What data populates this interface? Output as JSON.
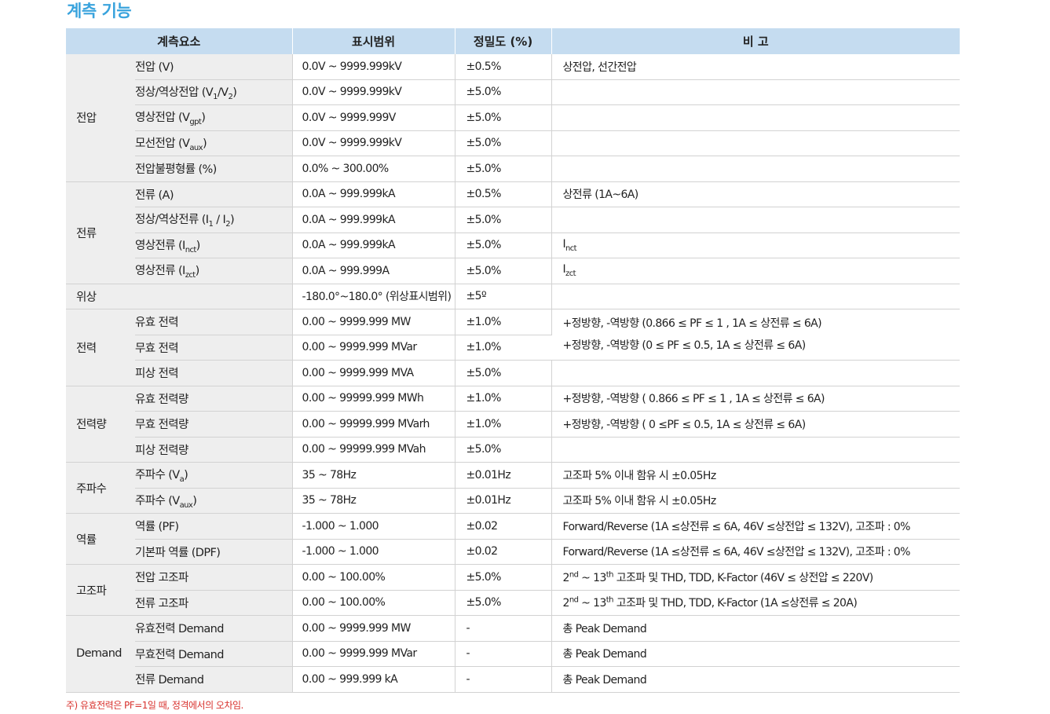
{
  "title": "계측 기능",
  "headers": {
    "element": "계측요소",
    "range": "표시범위",
    "accuracy": "정밀도 (%)",
    "note": "비 고"
  },
  "groups": [
    {
      "name": "전압",
      "rows": [
        {
          "item": "전압 (V)",
          "range": "0.0V ~ 9999.999kV",
          "accuracy": "±0.5%",
          "note": "상전압, 선간전압"
        },
        {
          "item": "정상/역상전압 (V1/V2)",
          "range": "0.0V ~ 9999.999kV",
          "accuracy": "±5.0%",
          "note": ""
        },
        {
          "item": "영상전압 (Vgpt)",
          "range": "0.0V ~ 9999.999V",
          "accuracy": "±5.0%",
          "note": ""
        },
        {
          "item": "모선전압 (Vaux)",
          "range": "0.0V ~ 9999.999kV",
          "accuracy": "±5.0%",
          "note": ""
        },
        {
          "item": "전압불평형률 (%)",
          "range": "0.0% ~ 300.00%",
          "accuracy": "±5.0%",
          "note": ""
        }
      ]
    },
    {
      "name": "전류",
      "rows": [
        {
          "item": "전류 (A)",
          "range": "0.0A ~ 999.999kA",
          "accuracy": "±0.5%",
          "note": "상전류 (1A~6A)"
        },
        {
          "item": "정상/역상전류 (I1 / I2)",
          "range": "0.0A ~ 999.999kA",
          "accuracy": "±5.0%",
          "note": ""
        },
        {
          "item": "영상전류 (Inct)",
          "range": "0.0A ~ 999.999kA",
          "accuracy": "±5.0%",
          "note": "Inct"
        },
        {
          "item": "영상전류 (Izct)",
          "range": "0.0A ~ 999.999A",
          "accuracy": "±5.0%",
          "note": "Izct"
        }
      ]
    },
    {
      "name": "위상",
      "rows": [
        {
          "item": "",
          "range": "-180.0°~180.0° (위상표시범위)",
          "accuracy": "±5º",
          "note": ""
        }
      ]
    },
    {
      "name": "전력",
      "rows": [
        {
          "item": "유효 전력",
          "range": "0.00 ~ 9999.999 MW",
          "accuracy": "±1.0%",
          "note": "+정방향, -역방향 (0.866 ≤ PF ≤ 1 , 1A ≤ 상전류 ≤ 6A)"
        },
        {
          "item": "무효 전력",
          "range": "0.00 ~ 9999.999 MVar",
          "accuracy": "±1.0%",
          "note": "+정방향, -역방향 (0 ≤ PF ≤ 0.5, 1A ≤ 상전류 ≤ 6A)"
        },
        {
          "item": "피상 전력",
          "range": "0.00 ~ 9999.999 MVA",
          "accuracy": "±5.0%",
          "note": ""
        }
      ]
    },
    {
      "name": "전력량",
      "rows": [
        {
          "item": "유효 전력량",
          "range": "0.00 ~ 99999.999 MWh",
          "accuracy": "±1.0%",
          "note": "+정방향, -역방향 ( 0.866 ≤ PF ≤ 1 , 1A ≤ 상전류 ≤ 6A)"
        },
        {
          "item": "무효 전력량",
          "range": "0.00 ~ 99999.999 MVarh",
          "accuracy": "±1.0%",
          "note": "+정방향, -역방향 ( 0 ≤PF ≤ 0.5, 1A ≤ 상전류 ≤ 6A)"
        },
        {
          "item": "피상 전력량",
          "range": "0.00 ~ 99999.999 MVah",
          "accuracy": "±5.0%",
          "note": ""
        }
      ]
    },
    {
      "name": "주파수",
      "rows": [
        {
          "item": "주파수 (Va)",
          "range": "35 ~ 78Hz",
          "accuracy": "±0.01Hz",
          "note": "고조파 5% 이내 함유 시 ±0.05Hz"
        },
        {
          "item": "주파수 (Vaux)",
          "range": "35 ~ 78Hz",
          "accuracy": "±0.01Hz",
          "note": "고조파 5% 이내 함유 시 ±0.05Hz"
        }
      ]
    },
    {
      "name": "역률",
      "rows": [
        {
          "item": "역률 (PF)",
          "range": "-1.000 ~ 1.000",
          "accuracy": "±0.02",
          "note": "Forward/Reverse (1A ≤상전류 ≤ 6A, 46V ≤상전압 ≤ 132V), 고조파 : 0%"
        },
        {
          "item": "기본파 역률 (DPF)",
          "range": "-1.000 ~ 1.000",
          "accuracy": "±0.02",
          "note": "Forward/Reverse (1A ≤상전류 ≤ 6A, 46V ≤상전압 ≤ 132V), 고조파 : 0%"
        }
      ]
    },
    {
      "name": "고조파",
      "rows": [
        {
          "item": "전압 고조파",
          "range": "0.00 ~ 100.00%",
          "accuracy": "±5.0%",
          "note": "2nd ~ 13th 고조파 및 THD, TDD, K-Factor (46V ≤ 상전압 ≤ 220V)"
        },
        {
          "item": "전류 고조파",
          "range": "0.00 ~ 100.00%",
          "accuracy": "±5.0%",
          "note": "2nd ~ 13th 고조파 및 THD, TDD, K-Factor (1A ≤상전류 ≤ 20A)"
        }
      ]
    },
    {
      "name": "Demand",
      "rows": [
        {
          "item": "유효전력 Demand",
          "range": "0.00 ~ 9999.999 MW",
          "accuracy": "-",
          "note": "총 Peak Demand"
        },
        {
          "item": "무효전력 Demand",
          "range": "0.00 ~ 9999.999 MVar",
          "accuracy": "-",
          "note": "총 Peak Demand"
        },
        {
          "item": "전류 Demand",
          "range": "0.00 ~ 999.999 kA",
          "accuracy": "-",
          "note": "총 Peak Demand"
        }
      ]
    }
  ],
  "footnote": "주) 유효전력은 PF=1일 때, 정격에서의 오차임."
}
